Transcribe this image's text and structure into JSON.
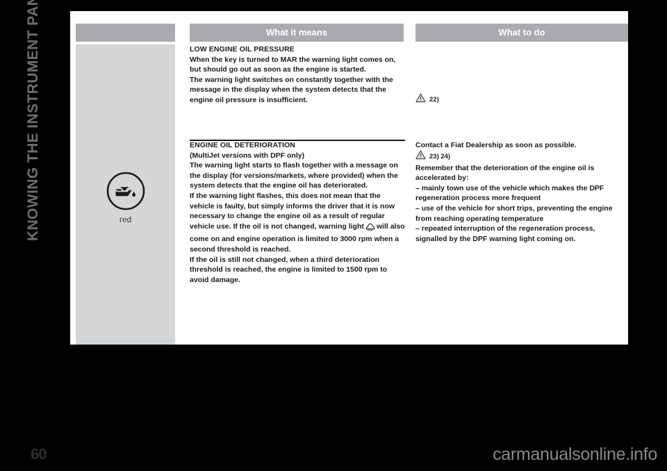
{
  "page": {
    "chapter_title": "KNOWING THE INSTRUMENT PANEL",
    "page_number": "60",
    "watermark": "carmanualsonline.info"
  },
  "table": {
    "headers": {
      "blank": "",
      "what_it_means": "What it means",
      "what_to_do": "What to do"
    },
    "icon": {
      "name": "oil-can-icon",
      "colour_label": "red"
    },
    "rows": [
      {
        "what_it_means": {
          "heading": "LOW ENGINE OIL PRESSURE",
          "paragraphs": [
            "When the key is turned to MAR the warning light comes on, but should go out as soon as the engine is started.",
            "The warning light switches on constantly together with the message in the display when the system detects that the engine oil pressure is insufficient."
          ]
        },
        "what_to_do": {
          "refs": "22)",
          "paragraphs": []
        }
      },
      {
        "what_it_means": {
          "heading": "ENGINE OIL DETERIORATION",
          "subheading": "(MultiJet versions with DPF only)",
          "paragraphs": [
            "The warning light starts to flash together with a message on the display (for versions/markets, where provided) when the system detects that the engine oil has deteriorated.",
            "If the warning light flashes, this does not mean that the vehicle is faulty, but simply informs the driver that it is now necessary to change the engine oil as a result of regular vehicle use. If the oil is not changed, warning light",
            "will also come on and engine operation is limited to 3000 rpm when a second threshold is reached.",
            "If the oil is still not changed, when a third deterioration threshold is reached, the engine is limited to 1500 rpm to avoid damage."
          ]
        },
        "what_to_do": {
          "intro": "Contact a Fiat Dealership as soon as possible.",
          "refs": "23) 24)",
          "paragraphs": [
            "Remember that the deterioration of the engine oil is accelerated by:"
          ],
          "bullets": [
            "– mainly town use of the vehicle which makes the DPF regeneration process more frequent",
            "– use of the vehicle for short trips, preventing the engine from reaching operating temperature",
            "– repeated interruption of the regeneration process, signalled by the DPF warning light coming on."
          ]
        }
      }
    ]
  },
  "colors": {
    "page_background": "#000000",
    "sheet_background": "#ffffff",
    "header_band": "#a9abae",
    "icon_column": "#d4d6d8",
    "text": "#1b1b1b",
    "chapter_title": "#6e6e6e"
  }
}
